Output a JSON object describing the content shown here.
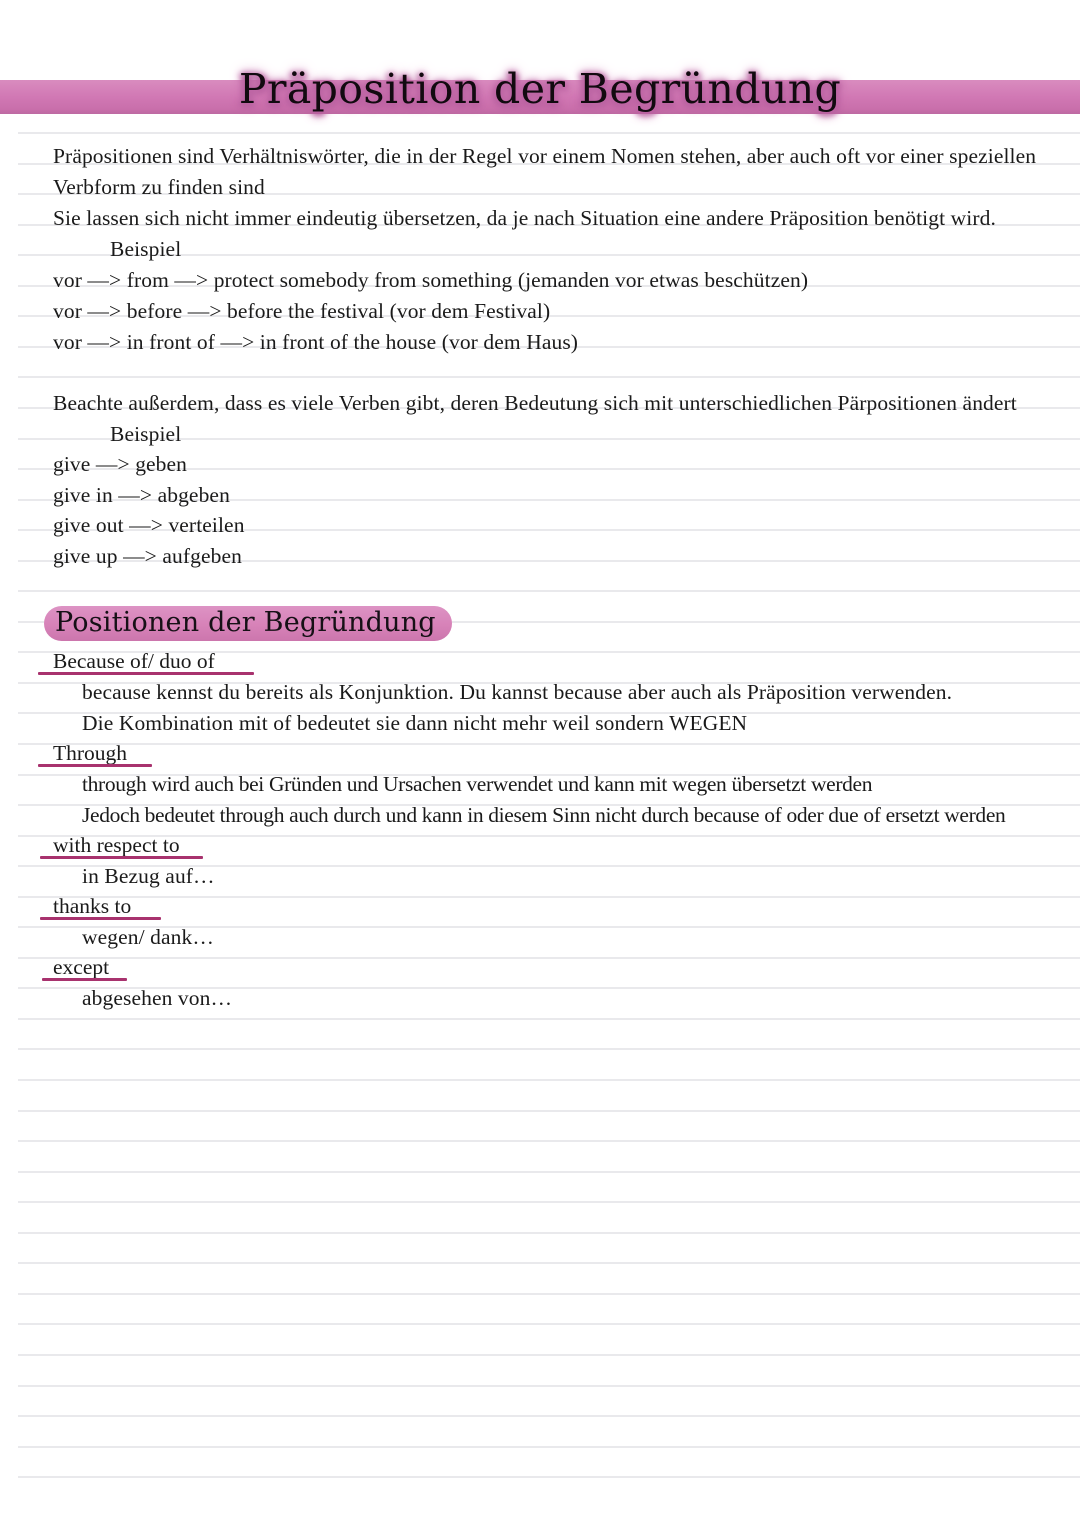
{
  "page": {
    "type": "handwritten-study-notes",
    "paper": "ruled",
    "rule_color": "#e9e9ec",
    "background": "#ffffff",
    "ink_color": "#1a1a1a"
  },
  "title": {
    "text": "Präposition der Begründung",
    "highlight_color": "#d178b4",
    "glow_color": "#c06aa8"
  },
  "intro": {
    "lines": [
      "Präpositionen sind Verhältniswörter, die in der Regel vor einem Nomen stehen, aber auch oft vor einer speziellen",
      "Verbform zu finden sind",
      "Sie lassen sich nicht immer eindeutig übersetzen, da je nach Situation eine andere Präposition benötigt wird."
    ]
  },
  "example_1": {
    "label": "Beispiel",
    "items": [
      "vor —> from —> protect somebody from something (jemanden vor etwas beschützen)",
      "vor —> before —> before the festival (vor dem Festival)",
      "vor —> in front of —> in front of the house (vor dem Haus)"
    ]
  },
  "note": {
    "text": "Beachte außerdem, dass es viele Verben gibt, deren Bedeutung sich mit unterschiedlichen Pärpositionen ändert"
  },
  "example_2": {
    "label": "Beispiel",
    "items": [
      "give —> geben",
      "give in —> abgeben",
      "give out —> verteilen",
      "give up —> aufgeben"
    ]
  },
  "section": {
    "heading": "Positionen der Begründung",
    "pill_color": "#d782b8",
    "underline_color": "#a8326e",
    "entries": [
      {
        "term": "Because of/ duo of",
        "underline_width": 210,
        "body": [
          "because kennst du bereits als Konjunktion. Du kannst because aber auch als Präposition verwenden.",
          "Die Kombination mit of bedeutet sie dann nicht mehr weil sondern WEGEN"
        ]
      },
      {
        "term": "Through",
        "underline_width": 108,
        "body": [
          "through wird auch bei Gründen und Ursachen verwendet und kann mit wegen übersetzt werden",
          "Jedoch bedeutet through auch durch und kann in diesem Sinn nicht durch because of oder due of ersetzt werden"
        ]
      },
      {
        "term": "with respect to",
        "underline_width": 158,
        "body": [
          "in Bezug auf…"
        ]
      },
      {
        "term": "thanks to",
        "underline_width": 112,
        "body": [
          "wegen/ dank…"
        ]
      },
      {
        "term": "except",
        "underline_width": 80,
        "body": [
          "abgesehen von…"
        ]
      }
    ]
  }
}
